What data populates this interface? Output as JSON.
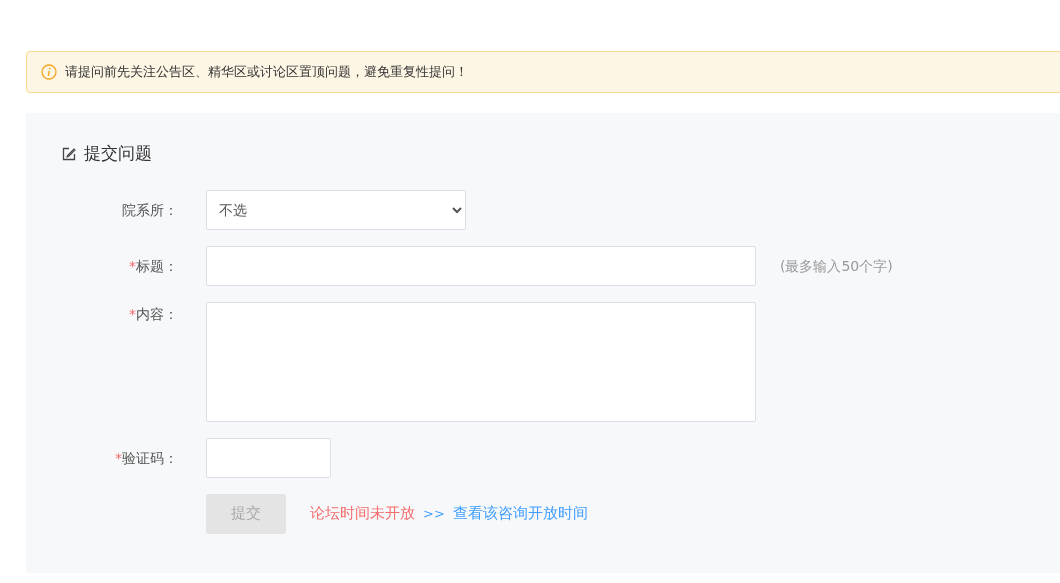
{
  "notice": {
    "text": "请提问前先关注公告区、精华区或讨论区置顶问题，避免重复性提问！"
  },
  "form": {
    "title": "提交问题",
    "fields": [
      {
        "kind": "select",
        "label": "院系所：",
        "value": "不选"
      },
      {
        "kind": "input",
        "label": "标题：",
        "required_mark": "*",
        "hint": "(最多输入50个字)"
      },
      {
        "kind": "textarea",
        "label": "内容：",
        "required_mark": "*"
      },
      {
        "kind": "captcha",
        "label": "验证码：",
        "required_mark": "*"
      }
    ],
    "submit": {
      "label": "提交",
      "disabled": true
    },
    "status": {
      "text": "论坛时间未开放",
      "separator": ">>",
      "link": "查看该咨询开放时间"
    }
  }
}
